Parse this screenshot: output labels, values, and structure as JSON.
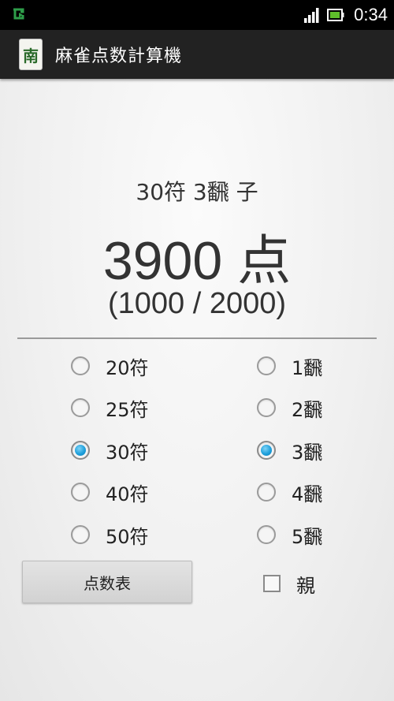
{
  "status_bar": {
    "time": "0:34",
    "icons": [
      "notification-icon",
      "signal-icon",
      "battery-icon"
    ]
  },
  "action_bar": {
    "app_icon_glyph": "南",
    "title": "麻雀点数計算機"
  },
  "result": {
    "hand": "30符 3飜 子",
    "points": "3900 点",
    "split": "(1000 / 2000)"
  },
  "fu_options": [
    {
      "label": "20符",
      "checked": false
    },
    {
      "label": "25符",
      "checked": false
    },
    {
      "label": "30符",
      "checked": true
    },
    {
      "label": "40符",
      "checked": false
    },
    {
      "label": "50符",
      "checked": false
    }
  ],
  "han_options": [
    {
      "label": "1飜",
      "checked": false
    },
    {
      "label": "2飜",
      "checked": false
    },
    {
      "label": "3飜",
      "checked": true
    },
    {
      "label": "4飜",
      "checked": false
    },
    {
      "label": "5飜",
      "checked": false
    }
  ],
  "controls": {
    "score_table_button": "点数表",
    "dealer_label": "親",
    "dealer_checked": false
  },
  "colors": {
    "radio_selected": "#1fa0dc",
    "action_bar_bg": "#222222"
  }
}
